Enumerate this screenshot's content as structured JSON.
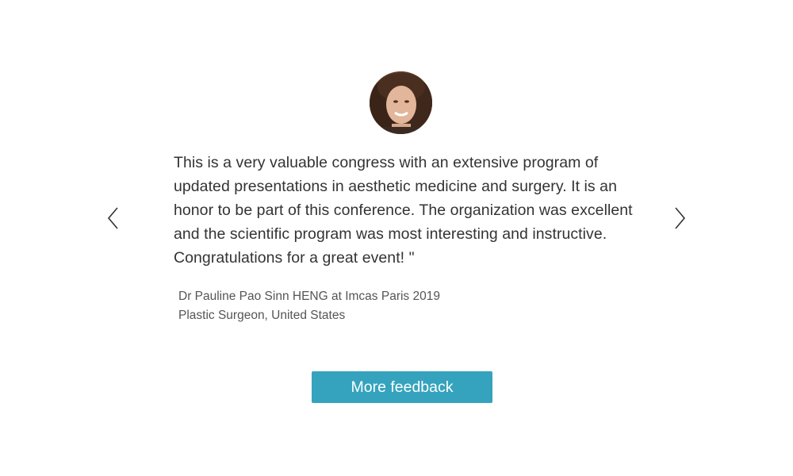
{
  "testimonial": {
    "quote": " This is a very valuable congress with an extensive program of updated presentations in aesthetic medicine and surgery. It is an honor to be part of this conference. The organization was excellent and the scientific program was most interesting and instructive.  Congratulations for a great event! \"",
    "author_line": "Dr Pauline Pao Sinn HENG at Imcas Paris 2019",
    "author_title": "Plastic Surgeon, United States"
  },
  "navigation": {
    "prev_icon": "chevron-left-icon",
    "next_icon": "chevron-right-icon"
  },
  "actions": {
    "more_feedback_label": "More feedback"
  },
  "colors": {
    "button_bg": "#35a3bd",
    "text": "#333333",
    "author_text": "#555555"
  }
}
